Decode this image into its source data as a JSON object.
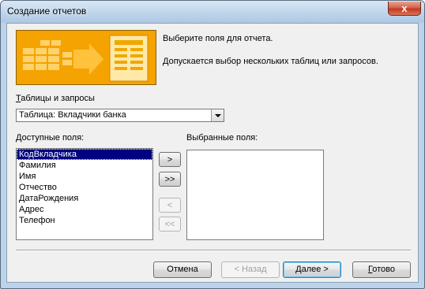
{
  "window": {
    "title": "Создание отчетов",
    "close_symbol": "x"
  },
  "intro": {
    "line1": "Выберите поля для отчета.",
    "line2": "Допускается выбор нескольких таблиц или запросов."
  },
  "tables": {
    "label_ul": "Т",
    "label_rest": "аблицы и запросы",
    "selected": "Таблица: Вкладчики банка"
  },
  "available": {
    "label_ul": "Д",
    "label_rest": "оступные поля:",
    "items": [
      "КодВкладчика",
      "Фамилия",
      "Имя",
      "Отчество",
      "ДатаРождения",
      "Адрес",
      "Телефон"
    ],
    "selected_index": 0
  },
  "chosen": {
    "label": "Выбранные поля:",
    "items": []
  },
  "move_buttons": {
    "add_one": ">",
    "add_all": ">>",
    "remove_one": "<",
    "remove_all": "<<"
  },
  "footer": {
    "cancel": "Отмена",
    "back": "< Назад",
    "next_ul": "Д",
    "next_rest": "алее >",
    "finish_ul": "Г",
    "finish_rest": "отово"
  }
}
